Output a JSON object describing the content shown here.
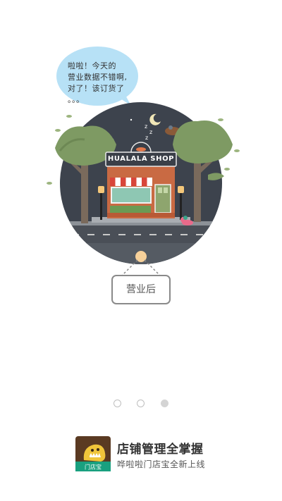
{
  "speech_bubble": {
    "lines": [
      "啦啦！今天的",
      "营业数据不错啊,",
      "对了！该订货了",
      "。。。"
    ]
  },
  "shop": {
    "name": "HUALALA SHOP"
  },
  "hanging_sign": {
    "label": "营业后"
  },
  "pager": {
    "count": 3,
    "active_index": 2
  },
  "footer": {
    "logo_label": "门店宝",
    "title": "店铺管理全掌握",
    "subtitle": "哗啦啦门店宝全新上线"
  },
  "colors": {
    "night_sky": "#3d434d",
    "tree_green": "#7e9a63",
    "bubble": "#b7e1f6",
    "lamp_glow": "#f4c77a",
    "brand_brown": "#5a3a22",
    "brand_green": "#19a07f"
  }
}
